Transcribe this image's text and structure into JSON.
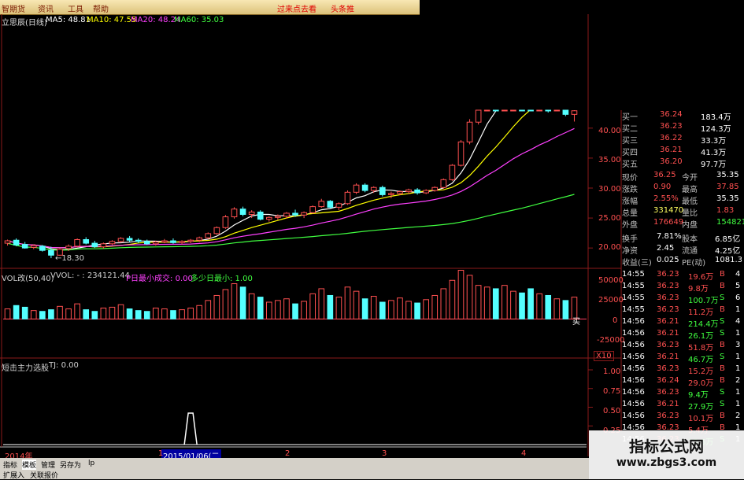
{
  "menu": {
    "items": [
      "智期货",
      "资讯",
      "工具",
      "帮助"
    ],
    "hot_items": [
      "过来点去看",
      "头条推"
    ]
  },
  "main": {
    "title_line": {
      "name": "立思辰(日线)",
      "ma5": "MA5: 48.81",
      "ma10": "MA10: 47.55",
      "ma20": "MA20: 48.24",
      "ma60": "MA60: 35.03"
    },
    "price_axis": [
      "40.00",
      "35.00",
      "30.00",
      "25.00",
      "20.00"
    ],
    "low_annotation": "←18.30"
  },
  "volume": {
    "title": "VOL改(50,40)",
    "vvol": "VVOL: - : 234121.44",
    "p_label": "P日最小成交: 0.00",
    "multi_label": "多少日最小: 1.00",
    "axis": [
      "50000",
      "25000",
      "0",
      "-25000"
    ],
    "unit": "X10",
    "sell_mark": "买"
  },
  "indicator": {
    "title": "短击主力选股",
    "tj": "TJ: 0.00",
    "axis": [
      "1.00",
      "0.75",
      "0.50",
      "0.25"
    ]
  },
  "timeline": {
    "year": "2014年",
    "date": "2015/01/06(二",
    "marks": [
      "1",
      "2",
      "3",
      "4"
    ]
  },
  "quote": {
    "bids": [
      {
        "label": "买一",
        "price": "36.24",
        "vol": "183.4万"
      },
      {
        "label": "买二",
        "price": "36.23",
        "vol": "124.3万"
      },
      {
        "label": "买三",
        "price": "36.22",
        "vol": "33.3万"
      },
      {
        "label": "买四",
        "price": "36.21",
        "vol": "41.3万"
      },
      {
        "label": "买五",
        "price": "36.20",
        "vol": "97.7万"
      }
    ],
    "stats": [
      {
        "l1": "现价",
        "v1": "36.25",
        "l2": "今开",
        "v2": "35.35",
        "c1": "#ff5050",
        "c2": "#ffffff"
      },
      {
        "l1": "涨跌",
        "v1": "0.90",
        "l2": "最高",
        "v2": "37.85",
        "c1": "#ff5050",
        "c2": "#ff5050"
      },
      {
        "l1": "涨幅",
        "v1": "2.55%",
        "l2": "最低",
        "v2": "35.35",
        "c1": "#ff5050",
        "c2": "#ffffff"
      },
      {
        "l1": "总量",
        "v1": "331470",
        "l2": "量比",
        "v2": "1.83",
        "c1": "#ffff60",
        "c2": "#ff5050"
      },
      {
        "l1": "外盘",
        "v1": "176649",
        "l2": "内盘",
        "v2": "154821",
        "c1": "#ff5050",
        "c2": "#40ff40"
      }
    ],
    "stats2": [
      {
        "l1": "换手",
        "v1": "7.81%",
        "l2": "股本",
        "v2": "6.85亿"
      },
      {
        "l1": "净资",
        "v1": "2.45",
        "l2": "流通",
        "v2": "4.25亿"
      },
      {
        "l1": "收益(三)",
        "v1": "0.025",
        "l2": "PE(动)",
        "v2": "1081.3"
      }
    ],
    "ticks": [
      {
        "time": "14:55",
        "price": "36.23",
        "vol": "19.6万",
        "side": "B",
        "n": "4"
      },
      {
        "time": "14:55",
        "price": "36.23",
        "vol": "9.8万",
        "side": "B",
        "n": "5"
      },
      {
        "time": "14:55",
        "price": "36.23",
        "vol": "100.7万",
        "side": "S",
        "n": "6"
      },
      {
        "time": "14:55",
        "price": "36.23",
        "vol": "11.2万",
        "side": "B",
        "n": "1"
      },
      {
        "time": "14:56",
        "price": "36.21",
        "vol": "214.4万",
        "side": "S",
        "n": "4"
      },
      {
        "time": "14:56",
        "price": "36.21",
        "vol": "26.1万",
        "side": "S",
        "n": "1"
      },
      {
        "time": "14:56",
        "price": "36.23",
        "vol": "51.8万",
        "side": "B",
        "n": "3"
      },
      {
        "time": "14:56",
        "price": "36.21",
        "vol": "46.7万",
        "side": "S",
        "n": "1"
      },
      {
        "time": "14:56",
        "price": "36.23",
        "vol": "15.2万",
        "side": "B",
        "n": "1"
      },
      {
        "time": "14:56",
        "price": "36.24",
        "vol": "29.0万",
        "side": "B",
        "n": "2"
      },
      {
        "time": "14:56",
        "price": "36.23",
        "vol": "9.4万",
        "side": "S",
        "n": "1"
      },
      {
        "time": "14:56",
        "price": "36.21",
        "vol": "27.9万",
        "side": "S",
        "n": "1"
      },
      {
        "time": "14:56",
        "price": "36.23",
        "vol": "10.1万",
        "side": "B",
        "n": "2"
      },
      {
        "time": "14:56",
        "price": "36.23",
        "vol": "5.4万",
        "side": "B",
        "n": "1"
      },
      {
        "time": "14:56",
        "price": "36.23",
        "vol": "15.6万",
        "side": "S",
        "n": "1"
      }
    ]
  },
  "bottom_tabs": [
    "指标",
    "模板",
    "管理",
    "另存为",
    "lp"
  ],
  "bottom_tabs2": [
    "扩展入",
    "关联报价"
  ],
  "watermark": {
    "title": "指标公式网",
    "url": "www.zbgs3.com"
  },
  "colors": {
    "up": "#ff5050",
    "down": "#54ffff",
    "ma5": "#ffffff",
    "ma10": "#ffff00",
    "ma20": "#ff40ff",
    "ma60": "#40ff40",
    "grid": "#8b1a1a"
  },
  "chart_data": {
    "type": "candlestick",
    "price_ylim": [
      17,
      43
    ],
    "candles": [
      [
        20.8,
        21.4,
        20.4,
        21.2
      ],
      [
        21.3,
        21.6,
        20.3,
        20.5
      ],
      [
        20.6,
        21.0,
        19.9,
        20.0
      ],
      [
        20.1,
        20.6,
        19.8,
        20.4
      ],
      [
        20.3,
        20.5,
        19.4,
        19.6
      ],
      [
        19.6,
        20.2,
        18.3,
        18.8
      ],
      [
        18.8,
        20.0,
        18.7,
        19.8
      ],
      [
        19.9,
        20.6,
        19.5,
        20.3
      ],
      [
        20.3,
        21.6,
        20.1,
        21.4
      ],
      [
        21.4,
        21.8,
        20.6,
        20.8
      ],
      [
        20.8,
        21.2,
        20.0,
        20.2
      ],
      [
        20.2,
        20.9,
        19.9,
        20.7
      ],
      [
        20.7,
        21.3,
        20.5,
        21.1
      ],
      [
        21.1,
        21.8,
        20.9,
        21.6
      ],
      [
        21.6,
        22.0,
        21.0,
        21.3
      ],
      [
        21.3,
        21.6,
        20.8,
        21.1
      ],
      [
        21.1,
        21.4,
        20.5,
        20.7
      ],
      [
        20.7,
        21.2,
        20.4,
        21.0
      ],
      [
        21.0,
        21.5,
        20.8,
        21.2
      ],
      [
        21.2,
        21.6,
        20.7,
        20.9
      ],
      [
        20.9,
        21.3,
        20.6,
        21.1
      ],
      [
        21.1,
        21.5,
        20.8,
        21.3
      ],
      [
        21.3,
        21.9,
        21.0,
        21.7
      ],
      [
        21.7,
        22.6,
        21.5,
        22.4
      ],
      [
        22.4,
        23.6,
        22.2,
        23.4
      ],
      [
        23.4,
        25.5,
        23.2,
        25.2
      ],
      [
        25.2,
        26.8,
        24.9,
        26.5
      ],
      [
        26.5,
        26.9,
        25.3,
        25.6
      ],
      [
        25.6,
        26.3,
        25.0,
        26.0
      ],
      [
        26.0,
        26.3,
        24.6,
        24.8
      ],
      [
        24.8,
        25.3,
        24.4,
        25.1
      ],
      [
        25.1,
        25.6,
        24.7,
        25.3
      ],
      [
        25.3,
        26.0,
        24.9,
        25.8
      ],
      [
        25.8,
        26.4,
        25.2,
        25.5
      ],
      [
        25.5,
        26.1,
        25.0,
        25.9
      ],
      [
        25.9,
        27.1,
        25.7,
        26.9
      ],
      [
        26.9,
        28.2,
        26.7,
        27.8
      ],
      [
        27.8,
        28.0,
        26.6,
        26.8
      ],
      [
        26.8,
        27.6,
        26.3,
        27.4
      ],
      [
        27.4,
        29.6,
        27.2,
        29.3
      ],
      [
        29.3,
        30.8,
        29.0,
        30.5
      ],
      [
        30.5,
        30.8,
        29.3,
        29.6
      ],
      [
        29.6,
        30.3,
        29.2,
        30.1
      ],
      [
        30.1,
        30.4,
        28.6,
        28.9
      ],
      [
        28.9,
        29.4,
        28.3,
        29.1
      ],
      [
        29.1,
        29.6,
        28.8,
        29.4
      ],
      [
        29.4,
        29.9,
        29.0,
        29.7
      ],
      [
        29.7,
        30.0,
        28.9,
        29.2
      ],
      [
        29.2,
        29.8,
        29.0,
        29.6
      ],
      [
        29.6,
        30.3,
        29.4,
        30.1
      ],
      [
        30.1,
        31.6,
        29.9,
        31.4
      ],
      [
        31.4,
        34.0,
        31.2,
        33.8
      ],
      [
        33.8,
        38.0,
        33.6,
        37.7
      ],
      [
        37.7,
        41.5,
        37.3,
        41.0
      ],
      [
        41.0,
        45.0,
        40.6,
        44.5
      ],
      [
        44.5,
        47.0,
        43.8,
        46.3
      ],
      [
        46.3,
        46.8,
        44.2,
        44.8
      ],
      [
        44.8,
        46.5,
        44.5,
        46.0
      ],
      [
        46.0,
        47.2,
        45.2,
        46.7
      ],
      [
        46.7,
        47.5,
        45.4,
        45.9
      ],
      [
        45.9,
        46.2,
        44.0,
        44.4
      ],
      [
        44.4,
        45.6,
        43.9,
        45.2
      ],
      [
        45.2,
        45.8,
        42.6,
        43.0
      ],
      [
        43.0,
        44.5,
        42.8,
        44.2
      ],
      [
        44.2,
        44.8,
        42.0,
        42.3
      ],
      [
        42.3,
        43.5,
        41.1,
        42.9
      ]
    ],
    "volume": [
      12,
      16,
      14,
      10,
      9,
      11,
      15,
      12,
      18,
      11,
      9,
      13,
      14,
      17,
      12,
      10,
      9,
      13,
      12,
      10,
      11,
      13,
      16,
      22,
      28,
      35,
      42,
      38,
      30,
      26,
      20,
      22,
      24,
      18,
      21,
      30,
      36,
      28,
      26,
      38,
      33,
      24,
      27,
      20,
      22,
      25,
      21,
      19,
      23,
      28,
      36,
      46,
      58,
      52,
      40,
      38,
      36,
      40,
      33,
      31,
      36,
      30,
      28,
      24,
      22,
      26
    ],
    "volume_ylim": [
      -25000,
      50000
    ],
    "indicator_signal_index": 21
  }
}
